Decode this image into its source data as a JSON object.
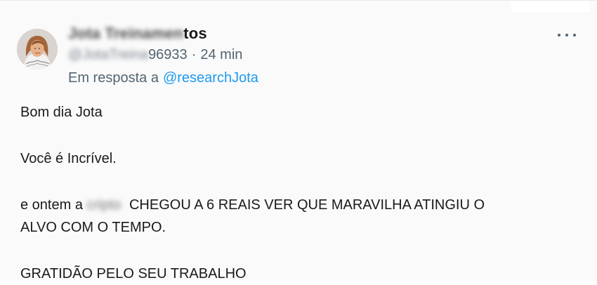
{
  "tweet": {
    "display_name_blurred": "Jota Treinamen",
    "display_name_visible": "tos",
    "handle_blurred": "@JotaTreina",
    "handle_visible": "96933",
    "time_separator": "·",
    "time": "24 min",
    "reply_prefix": "Em resposta a",
    "reply_to": "@researchJota",
    "body": {
      "p1": "Bom dia Jota",
      "p2": "Você é Incrível.",
      "p3_prefix": "e ontem a",
      "p3_blurred": "cripto",
      "p3_line1": "CHEGOU A 6 REAIS VER QUE MARAVILHA ATINGIU O",
      "p3_line2": "ALVO COM O TEMPO.",
      "p4": "GRATIDÃO PELO SEU TRABALHO"
    },
    "more_icon": "more-dots-icon"
  }
}
